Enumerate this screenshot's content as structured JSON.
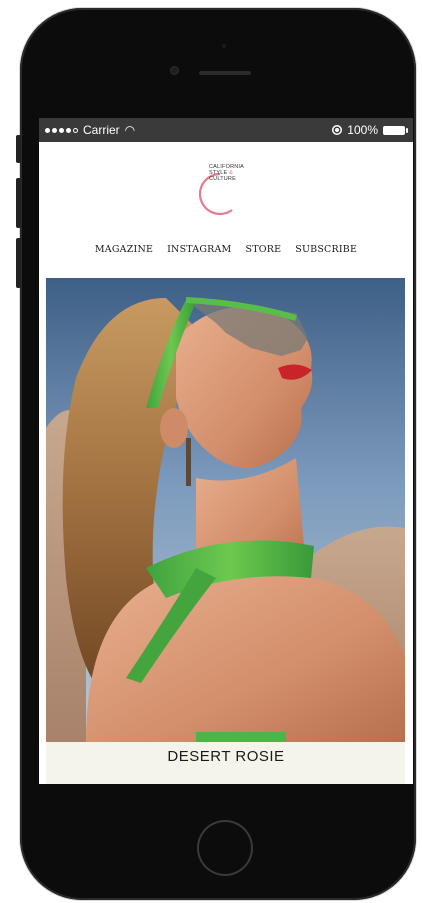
{
  "status_bar": {
    "carrier": "Carrier",
    "battery": "100%"
  },
  "logo": {
    "line1": "CALIFORNIA",
    "line2": "STYLE",
    "ampersand": "&",
    "line3": "CULTURE"
  },
  "nav": {
    "items": [
      "MAGAZINE",
      "INSTAGRAM",
      "STORE",
      "SUBSCRIBE"
    ]
  },
  "article": {
    "title": "DESERT ROSIE"
  },
  "colors": {
    "logo_pink": "#e77a8d",
    "caption_bg": "#f5f4ea",
    "status_bar_bg": "#3a3a3a"
  }
}
